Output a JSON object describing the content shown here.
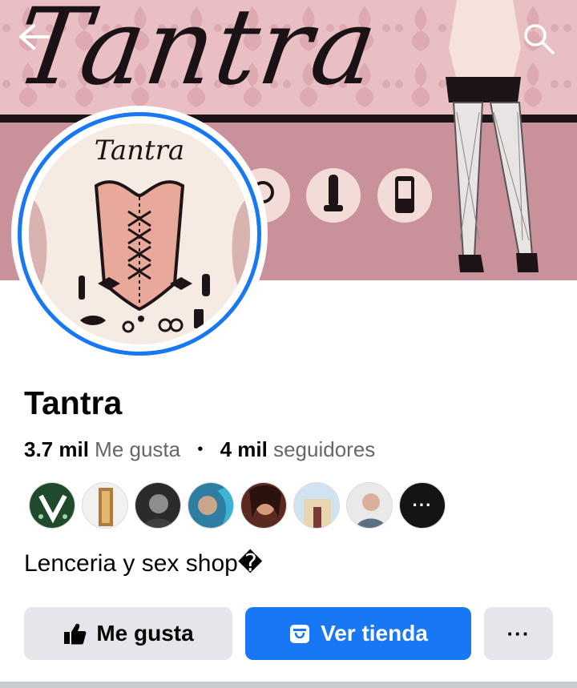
{
  "cover": {
    "title_text": "Tantra",
    "bg_color": "#c9929a",
    "pattern_color": "#ecc6c8"
  },
  "nav": {
    "back_icon": "arrow-left-icon",
    "search_icon": "search-icon"
  },
  "profile": {
    "avatar_text": "Tantra",
    "name": "Tantra",
    "likes_count": "3.7 mil",
    "likes_label": "Me gusta",
    "followers_count": "4 mil",
    "followers_label": "seguidores",
    "bio": "Lenceria y sex shop�"
  },
  "friends": {
    "more_label": "···"
  },
  "actions": {
    "like_label": "Me gusta",
    "shop_label": "Ver tienda",
    "more_label": "···"
  },
  "colors": {
    "accent": "#1877f2",
    "button_bg": "#e4e6eb",
    "secondary_text": "#65676b"
  }
}
